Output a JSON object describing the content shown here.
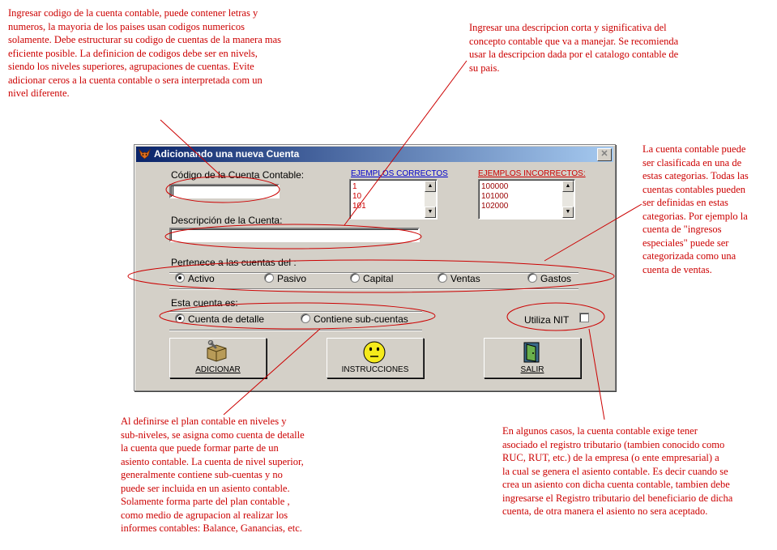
{
  "notes": {
    "codigo": "Ingresar codigo de la cuenta contable, puede contener letras y\nnumeros, la mayoria de los paises usan codigos numericos\nsolamente. Debe estructurar su codigo de cuentas de la manera mas\neficiente posible. La definicion de codigos debe ser en nivels,\nsiendo los niveles superiores, agrupaciones de cuentas. Evite\nadicionar ceros a la cuenta contable o sera interpretada com un\nnivel diferente.",
    "descripcion": "Ingresar una descripcion corta y significativa del\nconcepto contable que va a manejar. Se recomienda\nusar la descripcion dada por el catalogo contable de\nsu pais.",
    "categorias": "La cuenta contable puede\nser clasificada en una de\nestas categorias. Todas las\ncuentas contables pueden\nser definidas en estas\ncategorias. Por ejemplo la\ncuenta de \"ingresos\nespeciales\" puede ser\ncategorizada como una\ncuenta de ventas.",
    "niveles": "Al definirse el plan contable en niveles y\nsub-niveles, se asigna como cuenta de detalle\nla cuenta que puede formar parte de un\nasiento contable. La cuenta de nivel superior,\ngeneralmente contiene sub-cuentas y no\npuede ser incluida en un asiento contable.\nSolamente forma parte del plan contable ,\ncomo medio de agrupacion al realizar los\ninformes contables: Balance, Ganancias, etc.",
    "nit": "En algunos casos, la cuenta contable exige tener\nasociado el registro tributario (tambien conocido como\nRUC, RUT, etc.) de la empresa (o ente empresarial) a\nla cual se genera el asiento contable. Es decir cuando se\ncrea un asiento con dicha cuenta contable, tambien debe\ningresarse el Registro tributario del beneficiario de dicha\ncuenta, de otra manera el asiento no sera aceptado."
  },
  "dialog": {
    "title": "Adicionando una nueva Cuenta",
    "codigo_label": "Código de la Cuenta Contable:",
    "codigo_value": "",
    "ejemplos_correctos": {
      "header": "EJEMPLOS CORRECTOS",
      "items": [
        "1",
        "10",
        "101"
      ]
    },
    "ejemplos_incorrectos": {
      "header": "EJEMPLOS INCORRECTOS:",
      "items": [
        "100000",
        "101000",
        "102000"
      ]
    },
    "descripcion_label": "Descripción de la Cuenta:",
    "descripcion_value": "",
    "pertenece_label": "Pertenece a las cuentas del :",
    "categorias": [
      "Activo",
      "Pasivo",
      "Capital",
      "Ventas",
      "Gastos"
    ],
    "categoria_selected": "Activo",
    "tipo_label": "Esta cuenta es:",
    "tipos": [
      "Cuenta de detalle",
      "Contiene sub-cuentas"
    ],
    "tipo_selected": "Cuenta de detalle",
    "nit_label": "Utiliza NIT",
    "nit_checked": false,
    "buttons": {
      "adicionar": "ADICIONAR",
      "instrucciones": "INSTRUCCIONES",
      "salir": "SALIR"
    }
  },
  "colors": {
    "annotation": "#cc0000",
    "list_correct": "#cc0000",
    "header_correct": "#0000cc",
    "header_incorrect": "#cc0000",
    "list_incorrect": "#990000",
    "titlebar_start": "#0a246a",
    "titlebar_end": "#a6caf0",
    "dialog_face": "#d4d0c8"
  },
  "icons": {
    "titlebar": "app-fox-icon",
    "adicionar": "box-wrench-icon",
    "instrucciones": "smiley-icon",
    "salir": "exit-door-icon"
  }
}
